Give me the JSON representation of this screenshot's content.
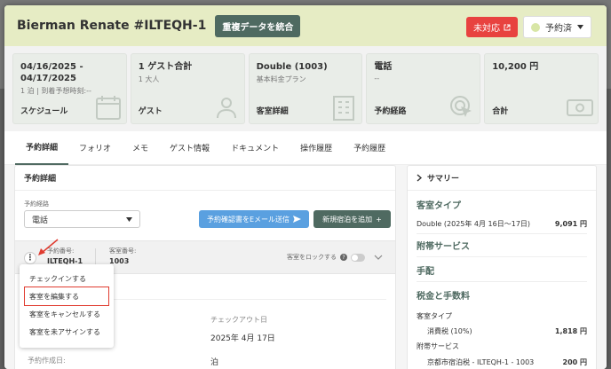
{
  "header": {
    "title": "Bierman Renate #ILTEQH-1",
    "merge_label": "重複データを統合",
    "unhandled_label": "未対応",
    "status_label": "予約済"
  },
  "cards": [
    {
      "main": "04/16/2025 -\n04/17/2025",
      "sub": "1 泊 | 到着予想時刻:--",
      "label": "スケジュール",
      "icon": "calendar-icon"
    },
    {
      "main": "1 ゲスト合計",
      "sub": "1 大人",
      "label": "ゲスト",
      "icon": "people-icon"
    },
    {
      "main": "Double (1003)",
      "sub": "基本料金プラン",
      "label": "客室詳細",
      "icon": "building-icon"
    },
    {
      "main": "電話",
      "sub": "--",
      "label": "予約経路",
      "icon": "cursor-icon"
    },
    {
      "main": "10,200 円",
      "sub": "",
      "label": "合計",
      "icon": "money-icon"
    }
  ],
  "tabs": [
    "予約詳細",
    "フォリオ",
    "メモ",
    "ゲスト情報",
    "ドキュメント",
    "操作履歴",
    "予約履歴"
  ],
  "details": {
    "title": "予約詳細",
    "route_label": "予約経路",
    "route_value": "電話",
    "email_button": "予約確認書をEメール送信",
    "add_button": "新規宿泊を追加",
    "reservation_no_label": "予約番号:",
    "reservation_no": "ILTEQH-1",
    "room_no_label": "客室番号:",
    "room_no": "1003",
    "lock_label": "客室をロックする",
    "checkout_label": "チェックアウト日",
    "checkout_value": "2025年 4月 17日",
    "created_label": "予約作成日:",
    "nights_value": "泊"
  },
  "menu": [
    "チェックインする",
    "客室を編集する",
    "客室をキャンセルする",
    "客室を未アサインする"
  ],
  "summary": {
    "title": "サマリー",
    "room_type_heading": "客室タイプ",
    "room_line": "Double (2025年 4月 16日〜17日)",
    "room_amount": "9,091 円",
    "addon_heading": "附帯サービス",
    "adjust_heading": "手配",
    "tax_heading": "税金と手数料",
    "tax_sub": "客室タイプ",
    "consumption_tax": "消費税 (10%)",
    "consumption_amount": "1,818 円",
    "addon_sub": "附帯サービス",
    "city_tax": "京都市宿泊税 - ILTEQH-1 - 1003",
    "city_tax_amount": "200 円"
  },
  "colors": {
    "accent": "#4f6a61",
    "header_bg": "#e6ecc4",
    "alert": "#e8423f",
    "primary_blue": "#5aa0e0"
  }
}
